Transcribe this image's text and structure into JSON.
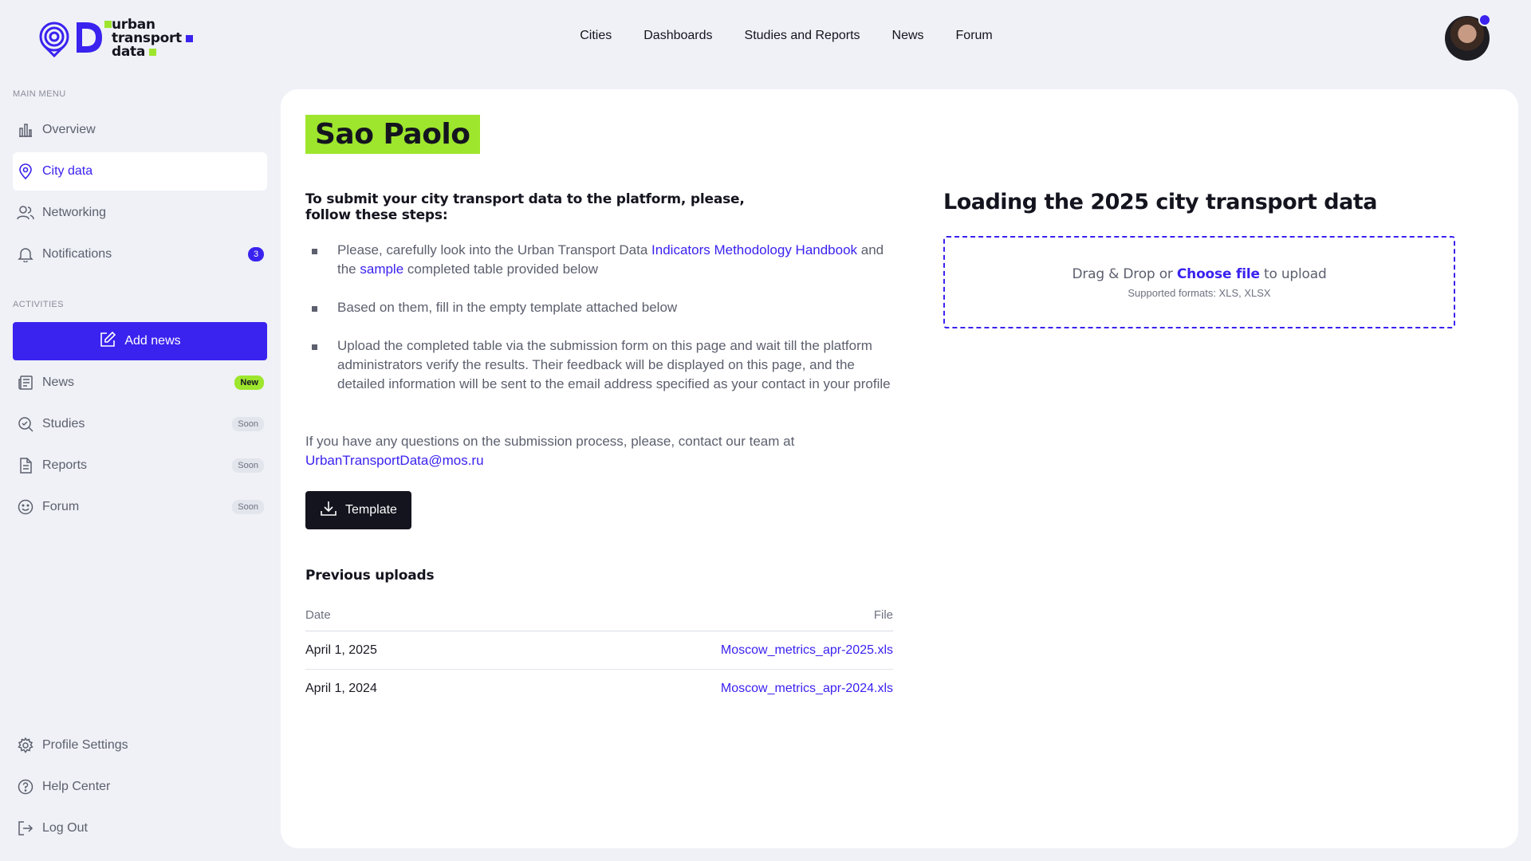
{
  "brand": {
    "line1": "urban",
    "line2": "transport",
    "line3": "data",
    "accent_purple": "#3a22ef",
    "accent_green": "#9ee62e"
  },
  "topnav": [
    "Cities",
    "Dashboards",
    "Studies and Reports",
    "News",
    "Forum"
  ],
  "sidebar": {
    "main_menu_label": "MAIN MENU",
    "items": [
      {
        "label": "Overview",
        "icon": "bar-chart-icon"
      },
      {
        "label": "City data",
        "icon": "map-pin-icon",
        "active": true
      },
      {
        "label": "Networking",
        "icon": "users-icon"
      },
      {
        "label": "Notifications",
        "icon": "bell-icon",
        "badge": "3"
      }
    ],
    "activities_label": "ACTIVITIES",
    "add_news_label": "Add news",
    "activity_items": [
      {
        "label": "News",
        "icon": "newspaper-icon",
        "badge": "New"
      },
      {
        "label": "Studies",
        "icon": "search-check-icon",
        "badge": "Soon"
      },
      {
        "label": "Reports",
        "icon": "document-icon",
        "badge": "Soon"
      },
      {
        "label": "Forum",
        "icon": "smile-icon",
        "badge": "Soon"
      }
    ],
    "bottom_items": [
      {
        "label": "Profile Settings",
        "icon": "gear-icon"
      },
      {
        "label": "Help Center",
        "icon": "help-circle-icon"
      },
      {
        "label": "Log Out",
        "icon": "logout-icon"
      }
    ]
  },
  "main": {
    "city": "Sao Paolo",
    "steps_heading": "To submit your city transport data to the platform, please, follow these steps:",
    "step1": {
      "a": "Please, carefully look into the Urban Transport Data ",
      "link1": "Indicators Methodology Handbook",
      "b": " and the ",
      "link2": "sample",
      "c": " completed table provided below"
    },
    "step2": "Based on them, fill in the empty template attached below",
    "step3": "Upload the completed table via the submission form on this page and wait till the platform administrators verify the results. Their feedback will be displayed on this page, and the detailed information will be sent to the email address specified as your contact in your profile",
    "contact_text": "If you have any questions on the submission process, please, contact our team at ",
    "contact_email": "UrbanTransportData@mos.ru",
    "template_button": "Template",
    "previous_uploads_heading": "Previous uploads",
    "table": {
      "col_date": "Date",
      "col_file": "File",
      "rows": [
        {
          "date": "April 1, 2025",
          "file": "Moscow_metrics_apr-2025.xls"
        },
        {
          "date": "April 1, 2024",
          "file": "Moscow_metrics_apr-2024.xls"
        }
      ]
    },
    "upload": {
      "title": "Loading the 2025 city transport data",
      "drag_text": "Drag & Drop or ",
      "choose_file": "Choose file",
      "to_upload": " to upload",
      "formats": "Supported formats: XLS, XLSX"
    }
  }
}
